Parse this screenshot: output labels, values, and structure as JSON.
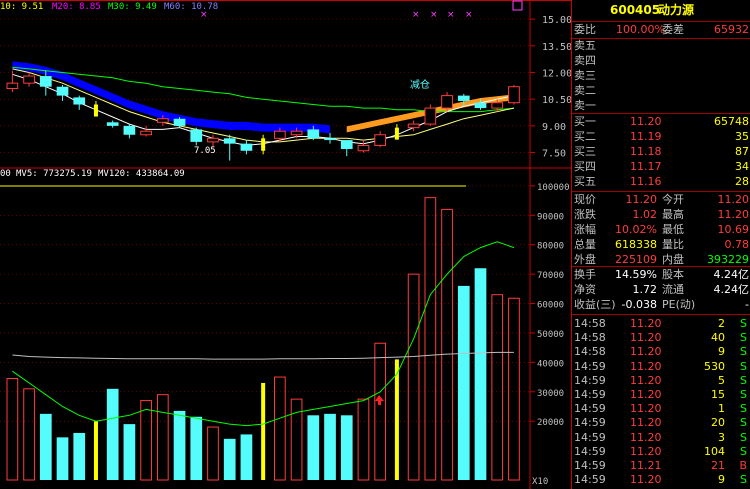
{
  "colors": {
    "up": "#ff3c3c",
    "down": "#54fcfc",
    "ma5": "#ffffff",
    "ma10": "#ffff00",
    "ma20": "#ff00ff",
    "ma30": "#00ff00",
    "ma60": "#0000ff",
    "label": "#c0c0c0",
    "grid": "#a00000",
    "axis": "#cc0000",
    "volume_ma": "#00ff00"
  },
  "top_legend": {
    "ma10": "10: 9.51",
    "ma20": "M20: 8.85",
    "ma30": "M30: 9.49",
    "ma60": "M60: 10.78"
  },
  "vol_legend": {
    "vol": "00",
    "mv5": "MV5: 773275.19",
    "mv120": "MV120: 433864.09"
  },
  "price_axis": [
    "15.00",
    "13.50",
    "12.00",
    "10.50",
    "9.00",
    "7.50"
  ],
  "volume_axis": [
    "100000",
    "90000",
    "80000",
    "70000",
    "60000",
    "50000",
    "40000",
    "30000",
    "20000"
  ],
  "volume_unit": "X10",
  "annotations": {
    "low": "7.05",
    "signal": "减仓",
    "up_arrow": "up-arrow-icon"
  },
  "chart_data": {
    "type": "candlestick",
    "price_range": [
      6.8,
      15.4
    ],
    "volume_range": [
      0,
      102000
    ],
    "candles": [
      {
        "o": 11.1,
        "c": 11.4,
        "h": 12.1,
        "l": 10.9,
        "v": 34500
      },
      {
        "o": 11.4,
        "c": 11.8,
        "h": 12.0,
        "l": 11.2,
        "v": 31000
      },
      {
        "o": 11.8,
        "c": 11.2,
        "h": 12.1,
        "l": 10.7,
        "v": 22500
      },
      {
        "o": 11.2,
        "c": 10.7,
        "h": 11.3,
        "l": 10.4,
        "v": 14500
      },
      {
        "o": 10.6,
        "c": 10.2,
        "h": 10.7,
        "l": 9.9,
        "v": 16000
      },
      {
        "o": 10.2,
        "c": 10.0,
        "h": 10.4,
        "l": 9.6,
        "v": 20000
      },
      {
        "o": 9.2,
        "c": 9.0,
        "h": 9.3,
        "l": 8.9,
        "v": 31000
      },
      {
        "o": 9.0,
        "c": 8.5,
        "h": 9.1,
        "l": 8.3,
        "v": 19000
      },
      {
        "o": 8.5,
        "c": 8.7,
        "h": 9.0,
        "l": 8.4,
        "v": 27000
      },
      {
        "o": 9.2,
        "c": 9.4,
        "h": 9.6,
        "l": 9.0,
        "v": 29000
      },
      {
        "o": 9.4,
        "c": 9.0,
        "h": 9.5,
        "l": 8.9,
        "v": 23500
      },
      {
        "o": 8.8,
        "c": 8.1,
        "h": 8.9,
        "l": 7.9,
        "v": 21500
      },
      {
        "o": 8.1,
        "c": 8.3,
        "h": 8.5,
        "l": 7.8,
        "v": 18000
      },
      {
        "o": 8.3,
        "c": 8.0,
        "h": 8.5,
        "l": 7.05,
        "v": 14000
      },
      {
        "o": 8.0,
        "c": 7.6,
        "h": 8.2,
        "l": 7.4,
        "v": 15500
      },
      {
        "o": 7.6,
        "c": 8.3,
        "h": 8.5,
        "l": 7.4,
        "v": 33000
      },
      {
        "o": 8.3,
        "c": 8.7,
        "h": 8.9,
        "l": 8.1,
        "v": 35000
      },
      {
        "o": 8.5,
        "c": 8.7,
        "h": 8.9,
        "l": 8.3,
        "v": 27500
      },
      {
        "o": 8.8,
        "c": 8.3,
        "h": 9.0,
        "l": 8.2,
        "v": 22000
      },
      {
        "o": 8.3,
        "c": 8.2,
        "h": 8.6,
        "l": 8.0,
        "v": 22500
      },
      {
        "o": 8.2,
        "c": 7.7,
        "h": 8.2,
        "l": 7.3,
        "v": 22000
      },
      {
        "o": 7.6,
        "c": 7.9,
        "h": 8.2,
        "l": 7.5,
        "v": 27500
      },
      {
        "o": 7.9,
        "c": 8.5,
        "h": 8.7,
        "l": 7.8,
        "v": 46500
      },
      {
        "o": 8.5,
        "c": 8.9,
        "h": 9.1,
        "l": 8.3,
        "v": 41000
      },
      {
        "o": 8.9,
        "c": 9.1,
        "h": 9.3,
        "l": 8.7,
        "v": 70000
      },
      {
        "o": 9.1,
        "c": 10.0,
        "h": 10.2,
        "l": 9.0,
        "v": 96000
      },
      {
        "o": 10.0,
        "c": 10.7,
        "h": 10.9,
        "l": 9.8,
        "v": 92000
      },
      {
        "o": 10.7,
        "c": 10.4,
        "h": 10.8,
        "l": 10.1,
        "v": 66000
      },
      {
        "o": 10.3,
        "c": 10.0,
        "h": 10.5,
        "l": 9.9,
        "v": 72000
      },
      {
        "o": 10.0,
        "c": 10.3,
        "h": 10.5,
        "l": 9.8,
        "v": 63000
      },
      {
        "o": 10.3,
        "c": 11.2,
        "h": 11.3,
        "l": 10.2,
        "v": 61800
      }
    ],
    "yellow_marks": [
      5,
      15,
      23
    ],
    "ma_fast": [
      11.9,
      11.6,
      11.2,
      10.8,
      10.3,
      9.9,
      9.5,
      9.1,
      8.8,
      8.8,
      8.9,
      8.6,
      8.3,
      8.1,
      7.9,
      8.0,
      8.2,
      8.4,
      8.4,
      8.3,
      8.1,
      8.0,
      8.2,
      8.5,
      8.9,
      9.3,
      9.8,
      10.1,
      10.3,
      10.5,
      10.7
    ],
    "ma_mid": [
      12.2,
      12.0,
      11.7,
      11.4,
      11.0,
      10.6,
      10.2,
      9.8,
      9.5,
      9.2,
      9.0,
      8.8,
      8.6,
      8.4,
      8.2,
      8.1,
      8.1,
      8.2,
      8.3,
      8.3,
      8.3,
      8.2,
      8.3,
      8.4,
      8.5,
      8.8,
      9.1,
      9.4,
      9.6,
      9.8,
      10.0
    ],
    "ma30": [
      12.3,
      12.2,
      12.1,
      12.0,
      11.9,
      11.8,
      11.7,
      11.5,
      11.4,
      11.2,
      11.1,
      11.0,
      10.9,
      10.8,
      10.6,
      10.5,
      10.4,
      10.3,
      10.2,
      10.1,
      10.1,
      10.0,
      10.0,
      9.9,
      9.9,
      9.8,
      9.8,
      9.8,
      9.8,
      9.9,
      10.0
    ],
    "ma60_band": [
      12.4,
      12.3,
      12.1,
      11.8,
      11.4,
      11.0,
      10.6,
      10.2,
      9.9,
      9.6,
      9.4,
      9.2,
      9.1,
      9.0,
      9.0,
      8.9,
      8.9,
      8.9,
      8.9,
      8.8
    ],
    "orange_band": [
      8.8,
      9.0,
      9.2,
      9.4,
      9.6,
      9.8,
      10.0,
      10.2,
      10.4,
      10.5,
      10.6
    ],
    "mv5": [
      37000,
      33000,
      29000,
      25000,
      22000,
      20000,
      21000,
      22000,
      24000,
      23000,
      22000,
      21000,
      20000,
      19000,
      18500,
      19000,
      21000,
      23000,
      24000,
      25000,
      26000,
      27000,
      30000,
      36000,
      48000,
      63000,
      70000,
      76000,
      79000,
      81000,
      79000
    ],
    "mv120": [
      42500,
      42000,
      41800,
      41600,
      41500,
      41400,
      41300,
      41200,
      41200,
      41200,
      41200,
      41200,
      41100,
      41100,
      41100,
      41100,
      41200,
      41200,
      41200,
      41300,
      41300,
      41400,
      41600,
      41800,
      42000,
      42400,
      42800,
      43000,
      43200,
      43400,
      43400
    ]
  },
  "panel": {
    "code": "600405",
    "name": "动力源",
    "webi_label": "委比",
    "webi_value": "100.00%",
    "weicha_label": "委差",
    "weicha_value": "65932",
    "sell": [
      {
        "label": "卖五",
        "price": "",
        "vol": ""
      },
      {
        "label": "卖四",
        "price": "",
        "vol": ""
      },
      {
        "label": "卖三",
        "price": "",
        "vol": ""
      },
      {
        "label": "卖二",
        "price": "",
        "vol": ""
      },
      {
        "label": "卖一",
        "price": "",
        "vol": ""
      }
    ],
    "buy": [
      {
        "label": "买一",
        "price": "11.20",
        "vol": "65748"
      },
      {
        "label": "买二",
        "price": "11.19",
        "vol": "35"
      },
      {
        "label": "买三",
        "price": "11.18",
        "vol": "87"
      },
      {
        "label": "买四",
        "price": "11.17",
        "vol": "34"
      },
      {
        "label": "买五",
        "price": "11.16",
        "vol": "28"
      }
    ],
    "stats": [
      {
        "l1": "现价",
        "v1": "11.20",
        "l2": "今开",
        "v2": "11.20",
        "c1": "up",
        "c2": "up"
      },
      {
        "l1": "涨跌",
        "v1": "1.02",
        "l2": "最高",
        "v2": "11.20",
        "c1": "up",
        "c2": "up"
      },
      {
        "l1": "涨幅",
        "v1": "10.02%",
        "l2": "最低",
        "v2": "10.69",
        "c1": "up",
        "c2": "up"
      },
      {
        "l1": "总量",
        "v1": "618338",
        "l2": "量比",
        "v2": "0.78",
        "c1": "yellow",
        "c2": "up"
      },
      {
        "l1": "外盘",
        "v1": "225109",
        "l2": "内盘",
        "v2": "393229",
        "c1": "up",
        "c2": "green"
      }
    ],
    "fund": [
      {
        "l1": "换手",
        "v1": "14.59%",
        "l2": "股本",
        "v2": "4.24亿"
      },
      {
        "l1": "净资",
        "v1": "1.72",
        "l2": "流通",
        "v2": "4.24亿"
      },
      {
        "l1": "收益(三)",
        "v1": "-0.038",
        "l2": "PE(动)",
        "v2": "-"
      }
    ],
    "ticks": [
      {
        "t": "14:58",
        "p": "11.20",
        "v": "2",
        "f": "S"
      },
      {
        "t": "14:58",
        "p": "11.20",
        "v": "40",
        "f": "S"
      },
      {
        "t": "14:58",
        "p": "11.20",
        "v": "9",
        "f": "S"
      },
      {
        "t": "14:59",
        "p": "11.20",
        "v": "530",
        "f": "S"
      },
      {
        "t": "14:59",
        "p": "11.20",
        "v": "5",
        "f": "S"
      },
      {
        "t": "14:59",
        "p": "11.20",
        "v": "15",
        "f": "S"
      },
      {
        "t": "14:59",
        "p": "11.20",
        "v": "1",
        "f": "S"
      },
      {
        "t": "14:59",
        "p": "11.20",
        "v": "20",
        "f": "S"
      },
      {
        "t": "14:59",
        "p": "11.20",
        "v": "3",
        "f": "S"
      },
      {
        "t": "14:59",
        "p": "11.20",
        "v": "104",
        "f": "S"
      },
      {
        "t": "14:59",
        "p": "11.21",
        "v": "21",
        "f": "B"
      },
      {
        "t": "14:59",
        "p": "11.20",
        "v": "9",
        "f": "S"
      }
    ]
  }
}
